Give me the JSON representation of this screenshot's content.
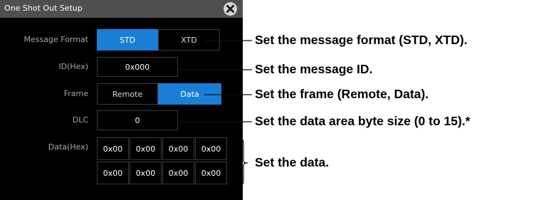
{
  "dialog": {
    "title": "One Shot Out Setup",
    "labels": {
      "message_format": "Message Format",
      "id": "ID(Hex)",
      "frame": "Frame",
      "dlc": "DLC",
      "data": "Data(Hex)"
    },
    "message_format": {
      "options": [
        "STD",
        "XTD"
      ],
      "selected": "STD"
    },
    "id_value": "0x000",
    "frame": {
      "options": [
        "Remote",
        "Data"
      ],
      "selected": "Data"
    },
    "dlc_value": "0",
    "data_bytes": [
      "0x00",
      "0x00",
      "0x00",
      "0x00",
      "0x00",
      "0x00",
      "0x00",
      "0x00"
    ]
  },
  "callouts": {
    "message_format": "Set the message format (STD, XTD).",
    "id": "Set the message ID.",
    "frame": "Set the frame (Remote, Data).",
    "dlc": "Set the data area byte size (0 to 15).*",
    "data": "Set the data."
  },
  "colors": {
    "panel_bg": "#000000",
    "titlebar_bg": "#4e4f51",
    "selected_button": "#1b7ed6",
    "label_text": "#a8a8a8"
  }
}
